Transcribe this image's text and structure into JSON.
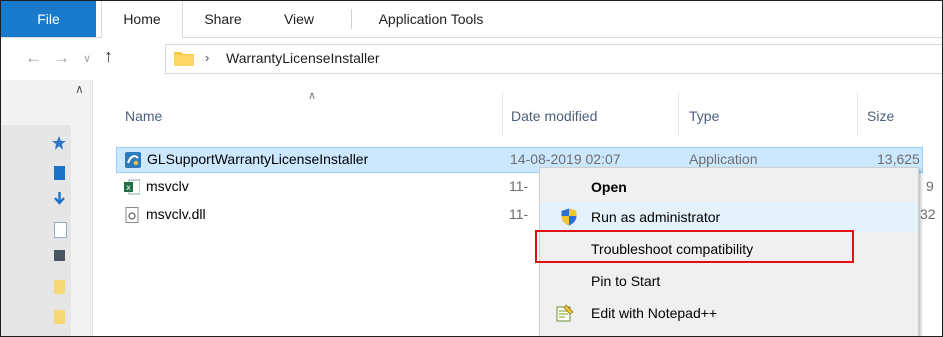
{
  "ribbon": {
    "tabs": [
      "File",
      "Home",
      "Share",
      "View",
      "Application Tools"
    ]
  },
  "address": {
    "path": "WarrantyLicenseInstaller",
    "separator": "›"
  },
  "columns": {
    "name": "Name",
    "date": "Date modified",
    "type": "Type",
    "size": "Size"
  },
  "files": [
    {
      "name": "GLSupportWarrantyLicenseInstaller",
      "date": "14-08-2019 02:07",
      "type": "Application",
      "size": "13,625",
      "icon": "application-icon"
    },
    {
      "name": "msvclv",
      "date": "11-",
      "type": "",
      "size": "9",
      "icon": "excel-file-icon"
    },
    {
      "name": "msvclv.dll",
      "date": "11-",
      "type": "",
      "size": "32",
      "icon": "dll-file-icon"
    }
  ],
  "context_menu": {
    "items": [
      {
        "label": "Open",
        "bold": true
      },
      {
        "label": "Run as administrator",
        "icon": "uac-shield-icon"
      },
      {
        "label": "Troubleshoot compatibility"
      },
      {
        "label": "Pin to Start"
      },
      {
        "label": "Edit with Notepad++",
        "icon": "notepad-plus-icon"
      }
    ]
  },
  "colors": {
    "file_tab": "#1979ca",
    "selection": "#cce8ff",
    "highlight_box": "#e01010"
  }
}
